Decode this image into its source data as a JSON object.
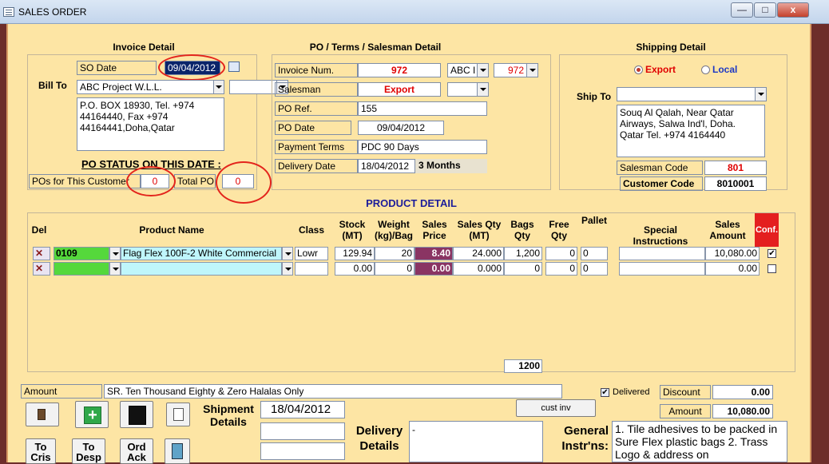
{
  "window": {
    "title": "SALES ORDER",
    "min_label": "—",
    "max_label": "□",
    "close_label": "x"
  },
  "invoice_detail": {
    "title": "Invoice Detail",
    "so_date_label": "SO Date",
    "so_date": "09/04/2012",
    "bill_to_label": "Bill To",
    "bill_to": "ABC Project W.L.L.",
    "address": "P.O. BOX 18930, Tel. +974 44164440, Fax +974 44164441,Doha,Qatar",
    "po_status_label": "PO STATUS ON THIS DATE :",
    "pos_for_customer_label": "POs for This Customer",
    "pos_for_customer": "0",
    "total_po_label": "Total PO",
    "total_po": "0"
  },
  "po_terms": {
    "title": "PO / Terms / Salesman Detail",
    "invoice_num_label": "Invoice Num.",
    "invoice_num": "972",
    "invoice_prefix": "ABC I",
    "invoice_num2": "972",
    "salesman_label": "Salesman",
    "salesman": "Export",
    "po_ref_label": "PO Ref.",
    "po_ref": "155",
    "po_date_label": "PO Date",
    "po_date": "09/04/2012",
    "payment_terms_label": "Payment Terms",
    "payment_terms": "PDC 90 Days",
    "delivery_date_label": "Delivery Date",
    "delivery_date": "18/04/2012",
    "delivery_period": "3 Months"
  },
  "shipping": {
    "title": "Shipping Detail",
    "export_label": "Export",
    "local_label": "Local",
    "ship_to_label": "Ship To",
    "ship_to": "",
    "address": "Souq Al Qalah, Near Qatar Airways, Salwa Ind'l, Doha. Qatar Tel. +974 4164440",
    "salesman_code_label": "Salesman Code",
    "salesman_code": "801",
    "customer_code_label": "Customer Code",
    "customer_code": "8010001"
  },
  "product_detail": {
    "title": "PRODUCT DETAIL",
    "columns": {
      "del": "Del",
      "product_name": "Product Name",
      "class": "Class",
      "stock": "Stock (MT)",
      "weight": "Weight (kg)/Bag",
      "sales_price": "Sales Price",
      "sales_qty": "Sales Qty (MT)",
      "bags_qty": "Bags Qty",
      "free_qty": "Free Qty",
      "pallet": "Pallet",
      "special": "Special Instructions",
      "sales_amount": "Sales Amount",
      "conf": "Conf."
    },
    "rows": [
      {
        "code": "0109",
        "product": "Flag Flex 100F-2 White Commercial",
        "class": "Lowr",
        "stock": "129.94",
        "weight": "20",
        "price": "8.40",
        "sales_qty": "24.000",
        "bags": "1,200",
        "free": "0",
        "pallet": "0",
        "special": "",
        "amount": "10,080.00",
        "conf": "✔"
      },
      {
        "code": "",
        "product": "",
        "class": "",
        "stock": "0.00",
        "weight": "0",
        "price": "0.00",
        "sales_qty": "0.000",
        "bags": "0",
        "free": "0",
        "pallet": "0",
        "special": "",
        "amount": "0.00",
        "conf": ""
      }
    ],
    "bags_total": "1200"
  },
  "footer": {
    "amount_label": "Amount",
    "amount_words": "SR. Ten Thousand Eighty & Zero Halalas Only",
    "delivered_label": "Delivered",
    "discount_label": "Discount",
    "discount": "0.00",
    "amount_label2": "Amount",
    "amount": "10,080.00",
    "cust_inv_label": "cust inv",
    "shipment_label": "Shipment Details",
    "shipment_date": "18/04/2012",
    "delivery_details_label": "Delivery Details",
    "delivery_details": "-",
    "general_instr_label": "General Instr'ns:",
    "general_instr": "1. Tile adhesives to be packed in Sure Flex  plastic bags 2. Trass Logo & address on",
    "to_cris": "To Cris",
    "to_desp": "To Desp",
    "ord_ack": "Ord Ack"
  }
}
